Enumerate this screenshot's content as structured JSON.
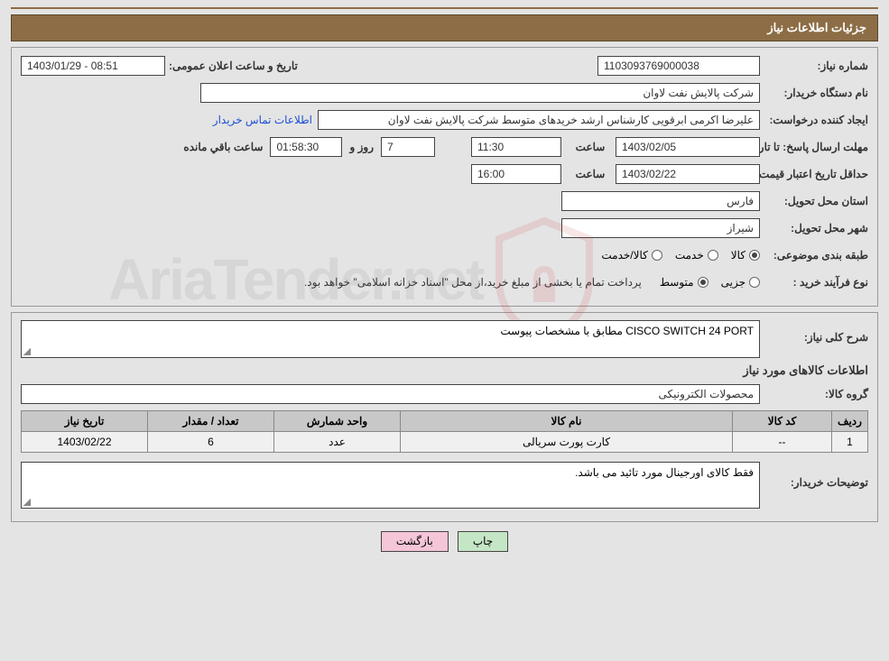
{
  "header": {
    "title": "جزئیات اطلاعات نیاز"
  },
  "need_number": {
    "label": "شماره نیاز:",
    "value": "1103093769000038"
  },
  "announce": {
    "label": "تاریخ و ساعت اعلان عمومی:",
    "value": "1403/01/29 - 08:51"
  },
  "buyer_org": {
    "label": "نام دستگاه خریدار:",
    "value": "شرکت پالایش نفت لاوان"
  },
  "requester": {
    "label": "ایجاد کننده درخواست:",
    "value": "علیرضا اکرمی ابرقویی کارشناس ارشد خریدهای متوسط شرکت پالایش نفت لاوان",
    "link": "اطلاعات تماس خریدار"
  },
  "deadline": {
    "label": "مهلت ارسال پاسخ: تا تاریخ:",
    "date": "1403/02/05",
    "time_label": "ساعت",
    "time": "11:30",
    "days": "7",
    "days_label": "روز و",
    "countdown": "01:58:30",
    "remain_label": "ساعت باقي مانده"
  },
  "validity": {
    "label": "حداقل تاریخ اعتبار قیمت: تا تاریخ:",
    "date": "1403/02/22",
    "time_label": "ساعت",
    "time": "16:00"
  },
  "province": {
    "label": "استان محل تحویل:",
    "value": "فارس"
  },
  "city": {
    "label": "شهر محل تحویل:",
    "value": "شیراز"
  },
  "classification": {
    "label": "طبقه بندی موضوعی:",
    "options": {
      "kala": "کالا",
      "khedmat": "خدمت",
      "kala_khedmat": "کالا/خدمت"
    }
  },
  "purchase_type": {
    "label": "نوع فرآیند خرید :",
    "options": {
      "partial": "جزیی",
      "medium": "متوسط"
    },
    "note": "پرداخت تمام یا بخشی از مبلغ خرید،از محل \"اسناد خزانه اسلامی\" خواهد بود."
  },
  "description": {
    "label": "شرح کلی نیاز:",
    "value": "CISCO SWITCH 24 PORT مطابق با مشخصات پیوست"
  },
  "goods_info_title": "اطلاعات کالاهای مورد نیاز",
  "group": {
    "label": "گروه کالا:",
    "value": "محصولات الکترونیکی"
  },
  "table": {
    "headers": {
      "row": "ردیف",
      "code": "کد کالا",
      "name": "نام کالا",
      "unit": "واحد شمارش",
      "qty": "تعداد / مقدار",
      "date": "تاریخ نیاز"
    },
    "rows": [
      {
        "row": "1",
        "code": "--",
        "name": "کارت پورت سریالی",
        "unit": "عدد",
        "qty": "6",
        "date": "1403/02/22"
      }
    ]
  },
  "buyer_notes": {
    "label": "توضیحات خریدار:",
    "value": "فقط کالای اورجینال مورد تائید می باشد."
  },
  "buttons": {
    "print": "چاپ",
    "back": "بازگشت"
  },
  "watermark": {
    "text": "AriaTender.net"
  }
}
